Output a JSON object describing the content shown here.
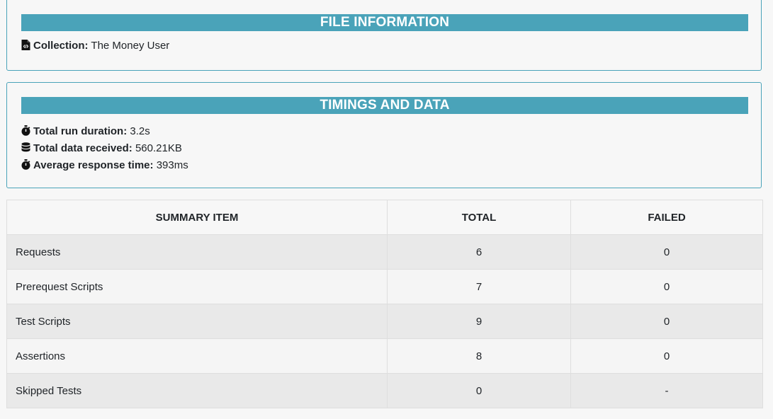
{
  "file_info": {
    "title": "FILE INFORMATION",
    "collection_label": "Collection:",
    "collection_value": "The Money User",
    "icon": "file-code-icon"
  },
  "timings": {
    "title": "TIMINGS AND DATA",
    "items": [
      {
        "icon": "stopwatch-icon",
        "label": "Total run duration:",
        "value": "3.2s"
      },
      {
        "icon": "database-icon",
        "label": "Total data received:",
        "value": "560.21KB"
      },
      {
        "icon": "stopwatch-icon",
        "label": "Average response time:",
        "value": "393ms"
      }
    ]
  },
  "summary": {
    "headers": [
      "SUMMARY ITEM",
      "TOTAL",
      "FAILED"
    ],
    "rows": [
      {
        "item": "Requests",
        "total": "6",
        "failed": "0"
      },
      {
        "item": "Prerequest Scripts",
        "total": "7",
        "failed": "0"
      },
      {
        "item": "Test Scripts",
        "total": "9",
        "failed": "0"
      },
      {
        "item": "Assertions",
        "total": "8",
        "failed": "0"
      },
      {
        "item": "Skipped Tests",
        "total": "0",
        "failed": "-"
      }
    ]
  },
  "colors": {
    "accent": "#4aa3b9",
    "background": "#f7f7f7",
    "row_striped": "#e9e9e9"
  }
}
